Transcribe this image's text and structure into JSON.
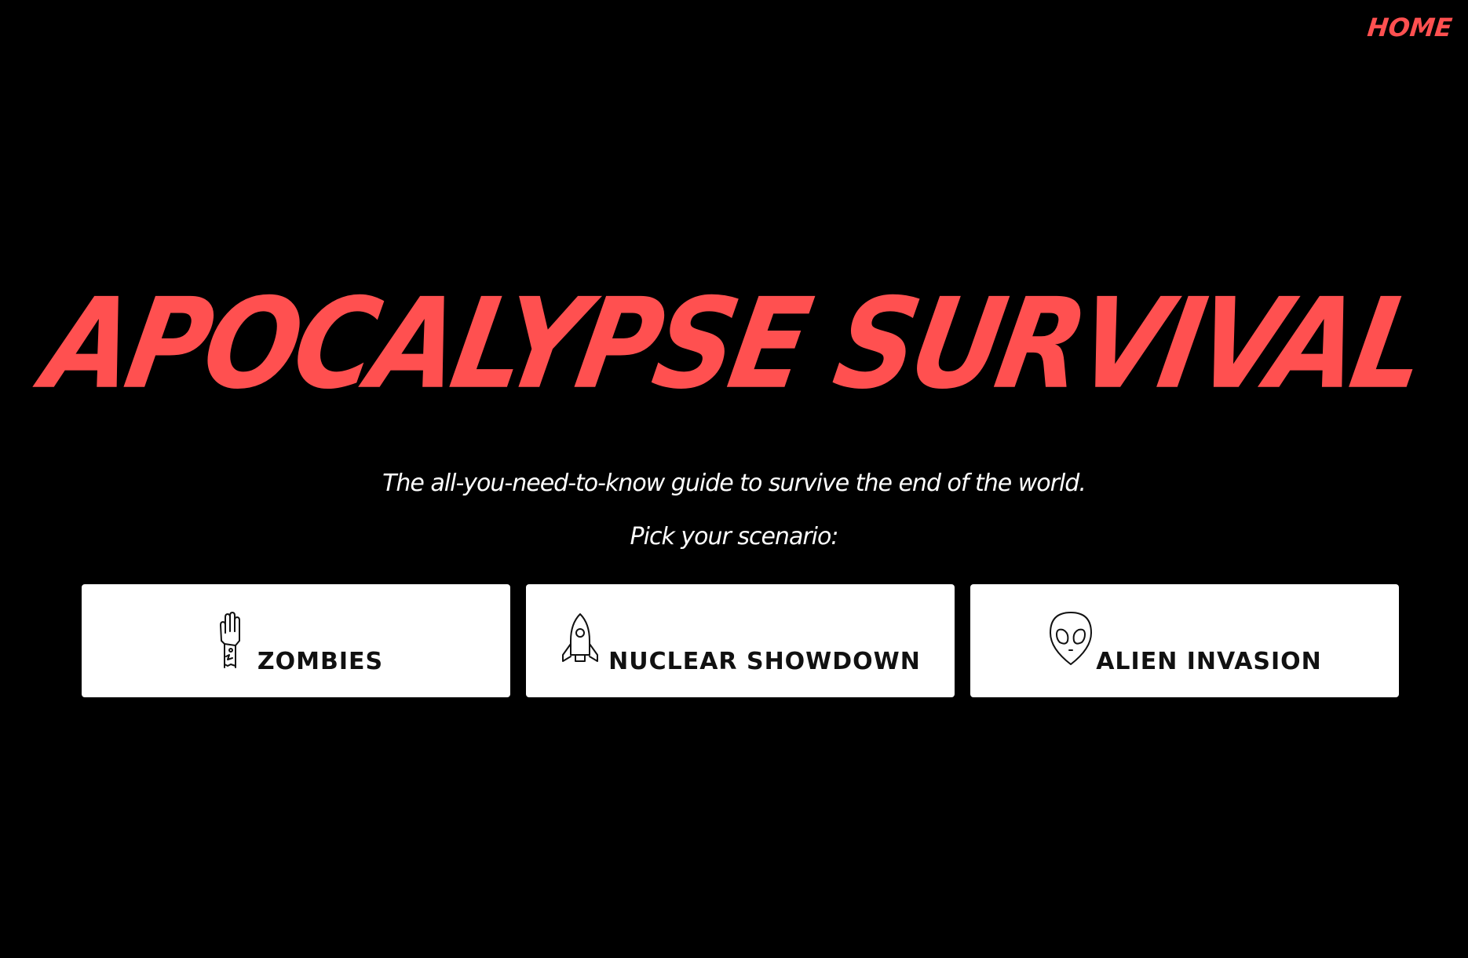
{
  "nav": {
    "home_label": "HOME"
  },
  "hero": {
    "title": "APOCALYPSE SURVIVAL",
    "subtitle": "The all-you-need-to-know guide to survive the end of the world.",
    "prompt": "Pick your scenario:"
  },
  "scenarios": [
    {
      "label": "ZOMBIES",
      "icon": "zombie-hand-icon"
    },
    {
      "label": "NUCLEAR SHOWDOWN",
      "icon": "rocket-icon"
    },
    {
      "label": "ALIEN INVASION",
      "icon": "alien-icon"
    }
  ],
  "colors": {
    "background": "#000000",
    "accent": "#ff5050",
    "card": "#ffffff",
    "text": "#ffffff"
  }
}
